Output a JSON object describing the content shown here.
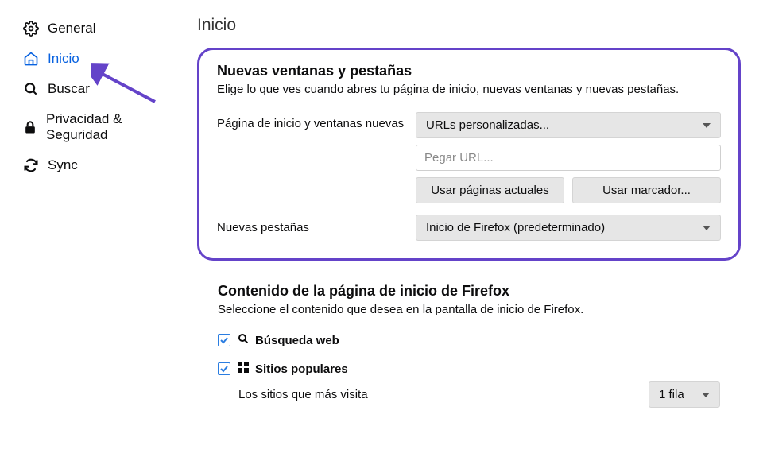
{
  "sidebar": {
    "items": [
      {
        "label": "General"
      },
      {
        "label": "Inicio"
      },
      {
        "label": "Buscar"
      },
      {
        "label": "Privacidad & Seguridad"
      },
      {
        "label": "Sync"
      }
    ]
  },
  "page": {
    "title": "Inicio"
  },
  "windows_section": {
    "title": "Nuevas ventanas y pestañas",
    "desc": "Elige lo que ves cuando abres tu página de inicio, nuevas ventanas y nuevas pestañas.",
    "homepage_label": "Página de inicio y ventanas nuevas",
    "homepage_select": "URLs personalizadas...",
    "url_placeholder": "Pegar URL...",
    "use_current": "Usar páginas actuales",
    "use_bookmark": "Usar marcador...",
    "newtab_label": "Nuevas pestañas",
    "newtab_select": "Inicio de Firefox (predeterminado)"
  },
  "content_section": {
    "title": "Contenido de la página de inicio de Firefox",
    "desc": "Seleccione el contenido que desea en la pantalla de inicio de Firefox.",
    "web_search": "Búsqueda web",
    "top_sites": "Sitios populares",
    "top_sites_desc": "Los sitios que más visita",
    "rows_select": "1 fila"
  }
}
